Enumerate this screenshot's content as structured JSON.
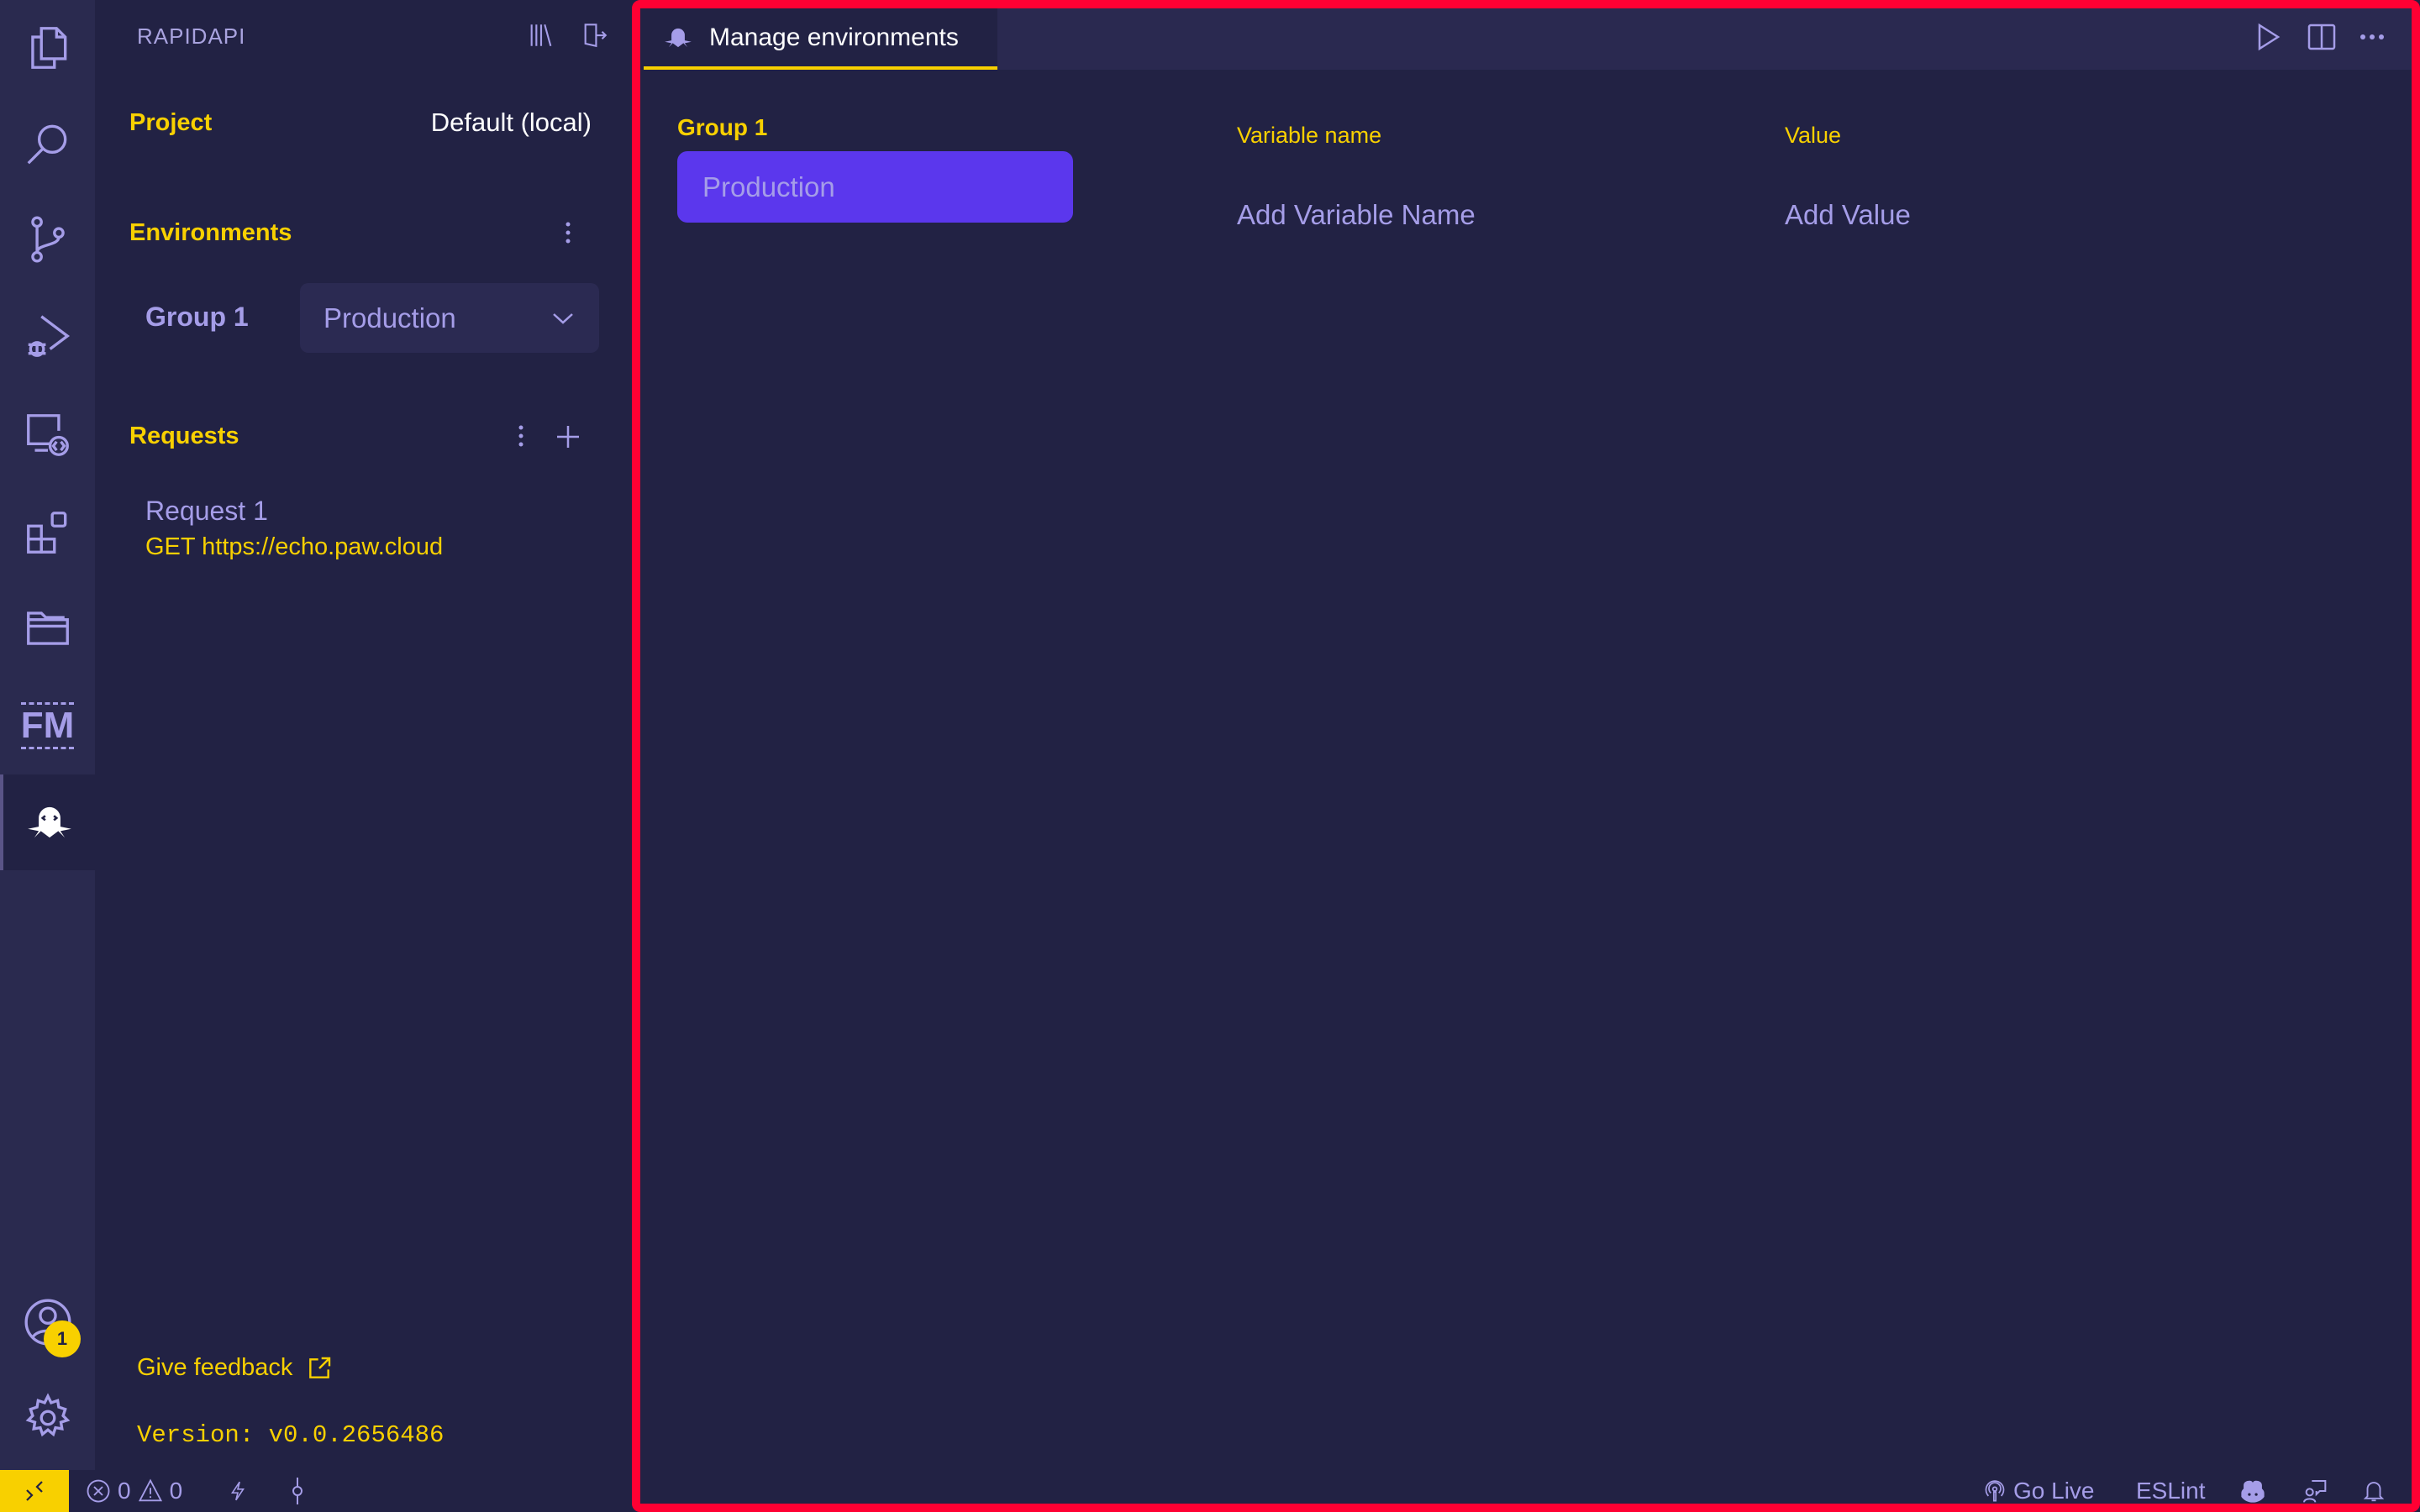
{
  "activity_bar": {
    "items": [
      {
        "name": "explorer"
      },
      {
        "name": "search"
      },
      {
        "name": "source-control"
      },
      {
        "name": "run-and-debug"
      },
      {
        "name": "remote-explorer"
      },
      {
        "name": "extensions"
      },
      {
        "name": "project-manager"
      },
      {
        "name": "fm"
      },
      {
        "name": "rapidapi",
        "active": true
      }
    ],
    "fm_label": "FM",
    "accounts_badge": "1"
  },
  "sidebar": {
    "title": "RAPIDAPI",
    "project_label": "Project",
    "project_value": "Default (local)",
    "environments_label": "Environments",
    "group_label": "Group 1",
    "environment_selected": "Production",
    "requests_label": "Requests",
    "requests": [
      {
        "name": "Request 1",
        "method_url": "GET https://echo.paw.cloud"
      }
    ],
    "feedback_label": "Give feedback",
    "version_label": "Version: v0.0.2656486"
  },
  "editor": {
    "tab_title": "Manage environments",
    "group_label": "Group 1",
    "environments": [
      "Production"
    ],
    "columns": {
      "name": "Variable name",
      "value": "Value"
    },
    "name_placeholder": "Add Variable Name",
    "value_placeholder": "Add Value"
  },
  "statusbar": {
    "errors": "0",
    "warnings": "0",
    "go_live": "Go Live",
    "eslint": "ESLint"
  },
  "colors": {
    "accent_yellow": "#f8d000",
    "accent_purple": "#5b37ed",
    "text_lavender": "#a59de8",
    "background": "#222244",
    "highlight_border": "#ff0033"
  }
}
